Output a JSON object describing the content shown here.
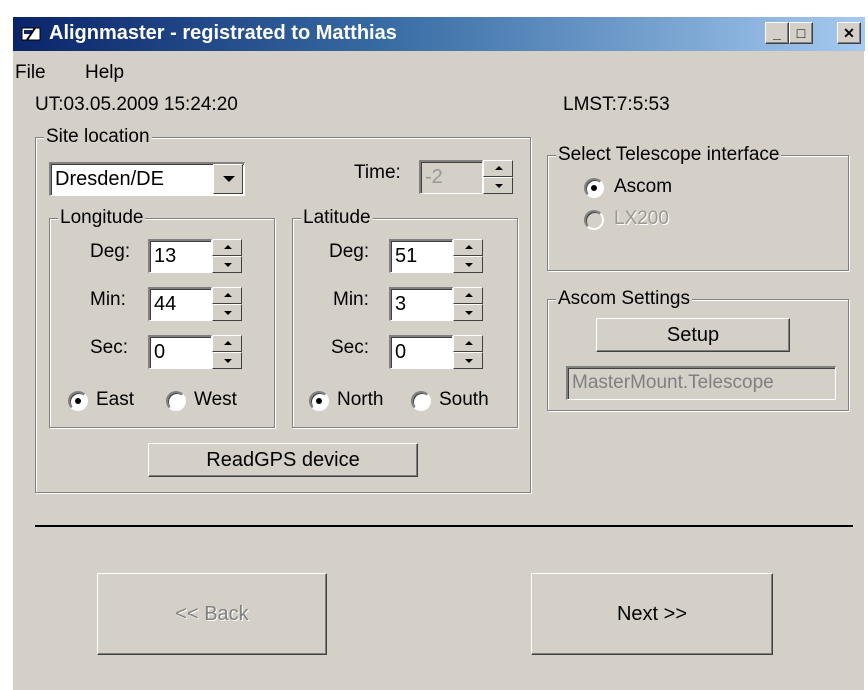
{
  "window": {
    "title": "Alignmaster - registrated to Matthias",
    "controls": {
      "minimize": "_",
      "maximize": "□",
      "close": "✕"
    }
  },
  "menu": {
    "file": "File",
    "help": "Help"
  },
  "status": {
    "ut": "UT:03.05.2009 15:24:20",
    "lmst": "LMST:7:5:53"
  },
  "site": {
    "group_label": "Site location",
    "location": "Dresden/DE",
    "time_label": "Time:",
    "time_value": "-2",
    "longitude": {
      "label": "Longitude",
      "deg_label": "Deg:",
      "deg": "13",
      "min_label": "Min:",
      "min": "44",
      "sec_label": "Sec:",
      "sec": "0",
      "east": "East",
      "west": "West",
      "selected": "East"
    },
    "latitude": {
      "label": "Latitude",
      "deg_label": "Deg:",
      "deg": "51",
      "min_label": "Min:",
      "min": "3",
      "sec_label": "Sec:",
      "sec": "0",
      "north": "North",
      "south": "South",
      "selected": "North"
    },
    "gps_button": "ReadGPS device"
  },
  "telescope": {
    "group_label": "Select Telescope interface",
    "ascom": "Ascom",
    "lx200": "LX200",
    "selected": "Ascom"
  },
  "ascom_settings": {
    "group_label": "Ascom Settings",
    "setup_button": "Setup",
    "driver": "MasterMount.Telescope"
  },
  "nav": {
    "back": "<< Back",
    "next": "Next >>"
  },
  "colors": {
    "face": "#d4d0c8",
    "title_start": "#0a246a",
    "title_end": "#a6caf0"
  }
}
